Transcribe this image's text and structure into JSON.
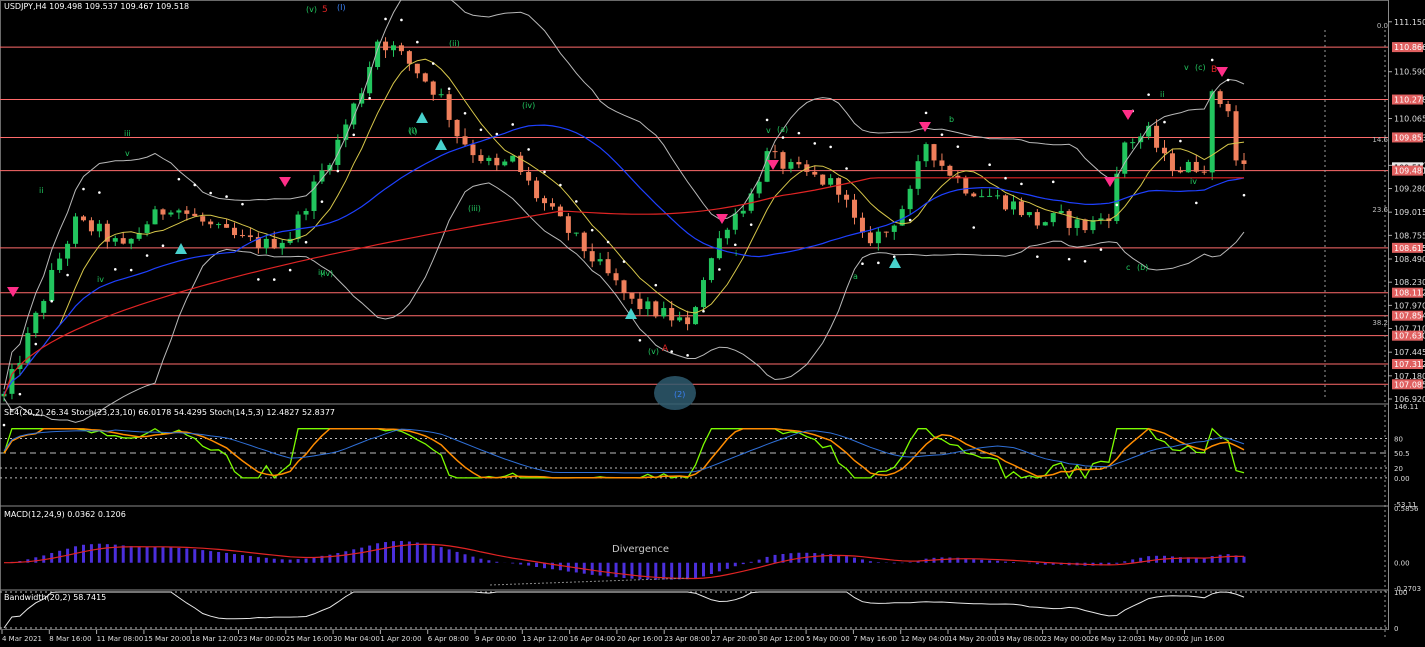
{
  "header": {
    "symbol_line": "USDJPY,H4  109.498 109.537 109.467 109.518",
    "stoch_line": "SE4(20,2) 26.34  Stoch(23,23,10) 66.0178 54.4295  Stoch(14,5,3) 12.4827 52.8377",
    "macd_line": "MACD(12,24,9) 0.0362 0.1206",
    "bw_line": "Bandwidth(20,2) 58.7415"
  },
  "annotations": {
    "divergence": "Divergence",
    "wave_labels": [
      {
        "text": "(v)",
        "color": "#22c55e"
      },
      {
        "text": "5",
        "color": "#e02424"
      },
      {
        "text": "(I)",
        "color": "#3b82f6"
      },
      {
        "text": "(ii)",
        "color": "#22c55e"
      },
      {
        "text": "(i)",
        "color": "#22c55e"
      },
      {
        "text": "(iii)",
        "color": "#22c55e"
      },
      {
        "text": "(iv)",
        "color": "#22c55e"
      },
      {
        "text": "(v)",
        "color": "#22c55e"
      },
      {
        "text": "A",
        "color": "#e02424"
      },
      {
        "text": "(2)",
        "color": "#3b82f6"
      },
      {
        "text": "v",
        "color": "#22c55e"
      },
      {
        "text": "(a)",
        "color": "#22c55e"
      },
      {
        "text": "a",
        "color": "#22c55e"
      },
      {
        "text": "b",
        "color": "#22c55e"
      },
      {
        "text": "c",
        "color": "#22c55e"
      },
      {
        "text": "(b)",
        "color": "#22c55e"
      },
      {
        "text": "ii",
        "color": "#22c55e"
      },
      {
        "text": "iv",
        "color": "#22c55e"
      },
      {
        "text": "v",
        "color": "#22c55e"
      },
      {
        "text": "(c)",
        "color": "#22c55e"
      },
      {
        "text": "B",
        "color": "#e02424"
      },
      {
        "text": "iii",
        "color": "#22c55e"
      },
      {
        "text": "iv",
        "color": "#22c55e"
      },
      {
        "text": "(iv)",
        "color": "#22c55e"
      },
      {
        "text": "ii",
        "color": "#22c55e"
      },
      {
        "text": "iv",
        "color": "#22c55e"
      },
      {
        "text": "v",
        "color": "#22c55e"
      },
      {
        "text": "(i)",
        "color": "#22c55e"
      },
      {
        "text": "i",
        "color": "#22c55e"
      }
    ]
  },
  "chart_data": {
    "type": "candlestick",
    "symbol": "USDJPY",
    "timeframe": "H4",
    "ohlc_last": {
      "open": 109.498,
      "high": 109.537,
      "low": 109.467,
      "close": 109.518
    },
    "ylim": [
      106.92,
      111.17
    ],
    "price_ticks": [
      111.15,
      110.59,
      110.065,
      109.54,
      109.28,
      109.015,
      108.755,
      108.49,
      108.23,
      107.97,
      107.71,
      107.445,
      107.18,
      106.92
    ],
    "x_labels": [
      "4 Mar 2021",
      "8 Mar 16:00",
      "11 Mar 08:00",
      "15 Mar 20:00",
      "18 Mar 12:00",
      "23 Mar 00:00",
      "25 Mar 16:00",
      "30 Mar 04:00",
      "1 Apr 20:00",
      "6 Apr 08:00",
      "9 Apr 00:00",
      "13 Apr 12:00",
      "16 Apr 04:00",
      "20 Apr 16:00",
      "23 Apr 08:00",
      "27 Apr 20:00",
      "30 Apr 12:00",
      "5 May 00:00",
      "7 May 16:00",
      "12 May 04:00",
      "14 May 20:00",
      "19 May 08:00",
      "23 May 00:00",
      "26 May 12:00",
      "31 May 00:00",
      "2 Jun 16:00"
    ],
    "price_path": [
      [
        0,
        106.95
      ],
      [
        3,
        107.6
      ],
      [
        6,
        108.3
      ],
      [
        9,
        108.9
      ],
      [
        12,
        108.8
      ],
      [
        15,
        108.6
      ],
      [
        18,
        108.9
      ],
      [
        21,
        109.1
      ],
      [
        24,
        108.95
      ],
      [
        27,
        108.8
      ],
      [
        30,
        108.7
      ],
      [
        33,
        108.65
      ],
      [
        36,
        108.75
      ],
      [
        39,
        109.3
      ],
      [
        42,
        109.8
      ],
      [
        45,
        110.4
      ],
      [
        47,
        110.95
      ],
      [
        49,
        110.85
      ],
      [
        52,
        110.6
      ],
      [
        55,
        110.3
      ],
      [
        57,
        109.9
      ],
      [
        59,
        109.7
      ],
      [
        62,
        109.5
      ],
      [
        64,
        109.6
      ],
      [
        67,
        109.2
      ],
      [
        70,
        108.9
      ],
      [
        73,
        108.6
      ],
      [
        76,
        108.3
      ],
      [
        79,
        108.0
      ],
      [
        82,
        107.9
      ],
      [
        85,
        107.8
      ],
      [
        86,
        107.7
      ],
      [
        88,
        108.3
      ],
      [
        91,
        108.9
      ],
      [
        94,
        109.2
      ],
      [
        96,
        109.65
      ],
      [
        99,
        109.5
      ],
      [
        102,
        109.4
      ],
      [
        105,
        109.3
      ],
      [
        108,
        108.7
      ],
      [
        111,
        108.8
      ],
      [
        114,
        109.2
      ],
      [
        116,
        109.8
      ],
      [
        118,
        109.55
      ],
      [
        121,
        109.3
      ],
      [
        124,
        109.2
      ],
      [
        127,
        109.1
      ],
      [
        130,
        108.9
      ],
      [
        133,
        108.95
      ],
      [
        136,
        108.85
      ],
      [
        139,
        109.0
      ],
      [
        141,
        109.8
      ],
      [
        144,
        109.9
      ],
      [
        146,
        109.6
      ],
      [
        148,
        109.5
      ],
      [
        151,
        109.55
      ],
      [
        152,
        110.3
      ],
      [
        154,
        110.2
      ],
      [
        155,
        109.6
      ],
      [
        156,
        109.52
      ]
    ],
    "horizontal_levels": [
      110.866,
      110.278,
      109.853,
      109.481,
      108.615,
      108.112,
      107.854,
      107.63,
      107.312,
      107.085
    ],
    "right_labels": [
      {
        "value": 110.866,
        "text": "110.866"
      },
      {
        "value": 110.278,
        "text": "110.278"
      },
      {
        "value": 109.853,
        "text": "109.853"
      },
      {
        "value": 109.518,
        "text": "109.518"
      },
      {
        "value": 109.481,
        "text": "109.481"
      },
      {
        "value": 108.615,
        "text": "108.615"
      },
      {
        "value": 108.112,
        "text": "108.112"
      },
      {
        "value": 107.854,
        "text": "107.854"
      },
      {
        "value": 107.63,
        "text": "107.630"
      },
      {
        "value": 107.312,
        "text": "107.312"
      },
      {
        "value": 107.085,
        "text": "107.085"
      }
    ],
    "fib_labels": [
      "0.0",
      "14.6",
      "23.6",
      "38.2"
    ],
    "stoch": {
      "ylim": [
        -53.11,
        146.11
      ],
      "ticks": [
        146.11,
        80,
        50.5,
        20,
        0.0,
        -53.11
      ]
    },
    "macd": {
      "ylim": [
        -0.2703,
        0.5856
      ],
      "ticks": [
        0.5856,
        0.0,
        -0.2703
      ]
    },
    "bandwidth": {
      "ticks": [
        100,
        0
      ]
    },
    "colors": {
      "candle_up": "#22c55e",
      "candle_down": "#ef7f5b",
      "level_line": "#ff6b6b",
      "ma_red": "#e02424",
      "ma_blue": "#1e40ff",
      "ma_yellow": "#d6c64a",
      "bands": "#b8b8b8",
      "psar": "#ffffff",
      "stoch_green": "#7cfc00",
      "stoch_orange": "#ff8c00",
      "macd_bar": "#4b2fdc",
      "macd_signal": "#e02424",
      "label_bg": "#e06060",
      "arrow_down": "#ff2e88",
      "arrow_up": "#48d1cc"
    }
  }
}
